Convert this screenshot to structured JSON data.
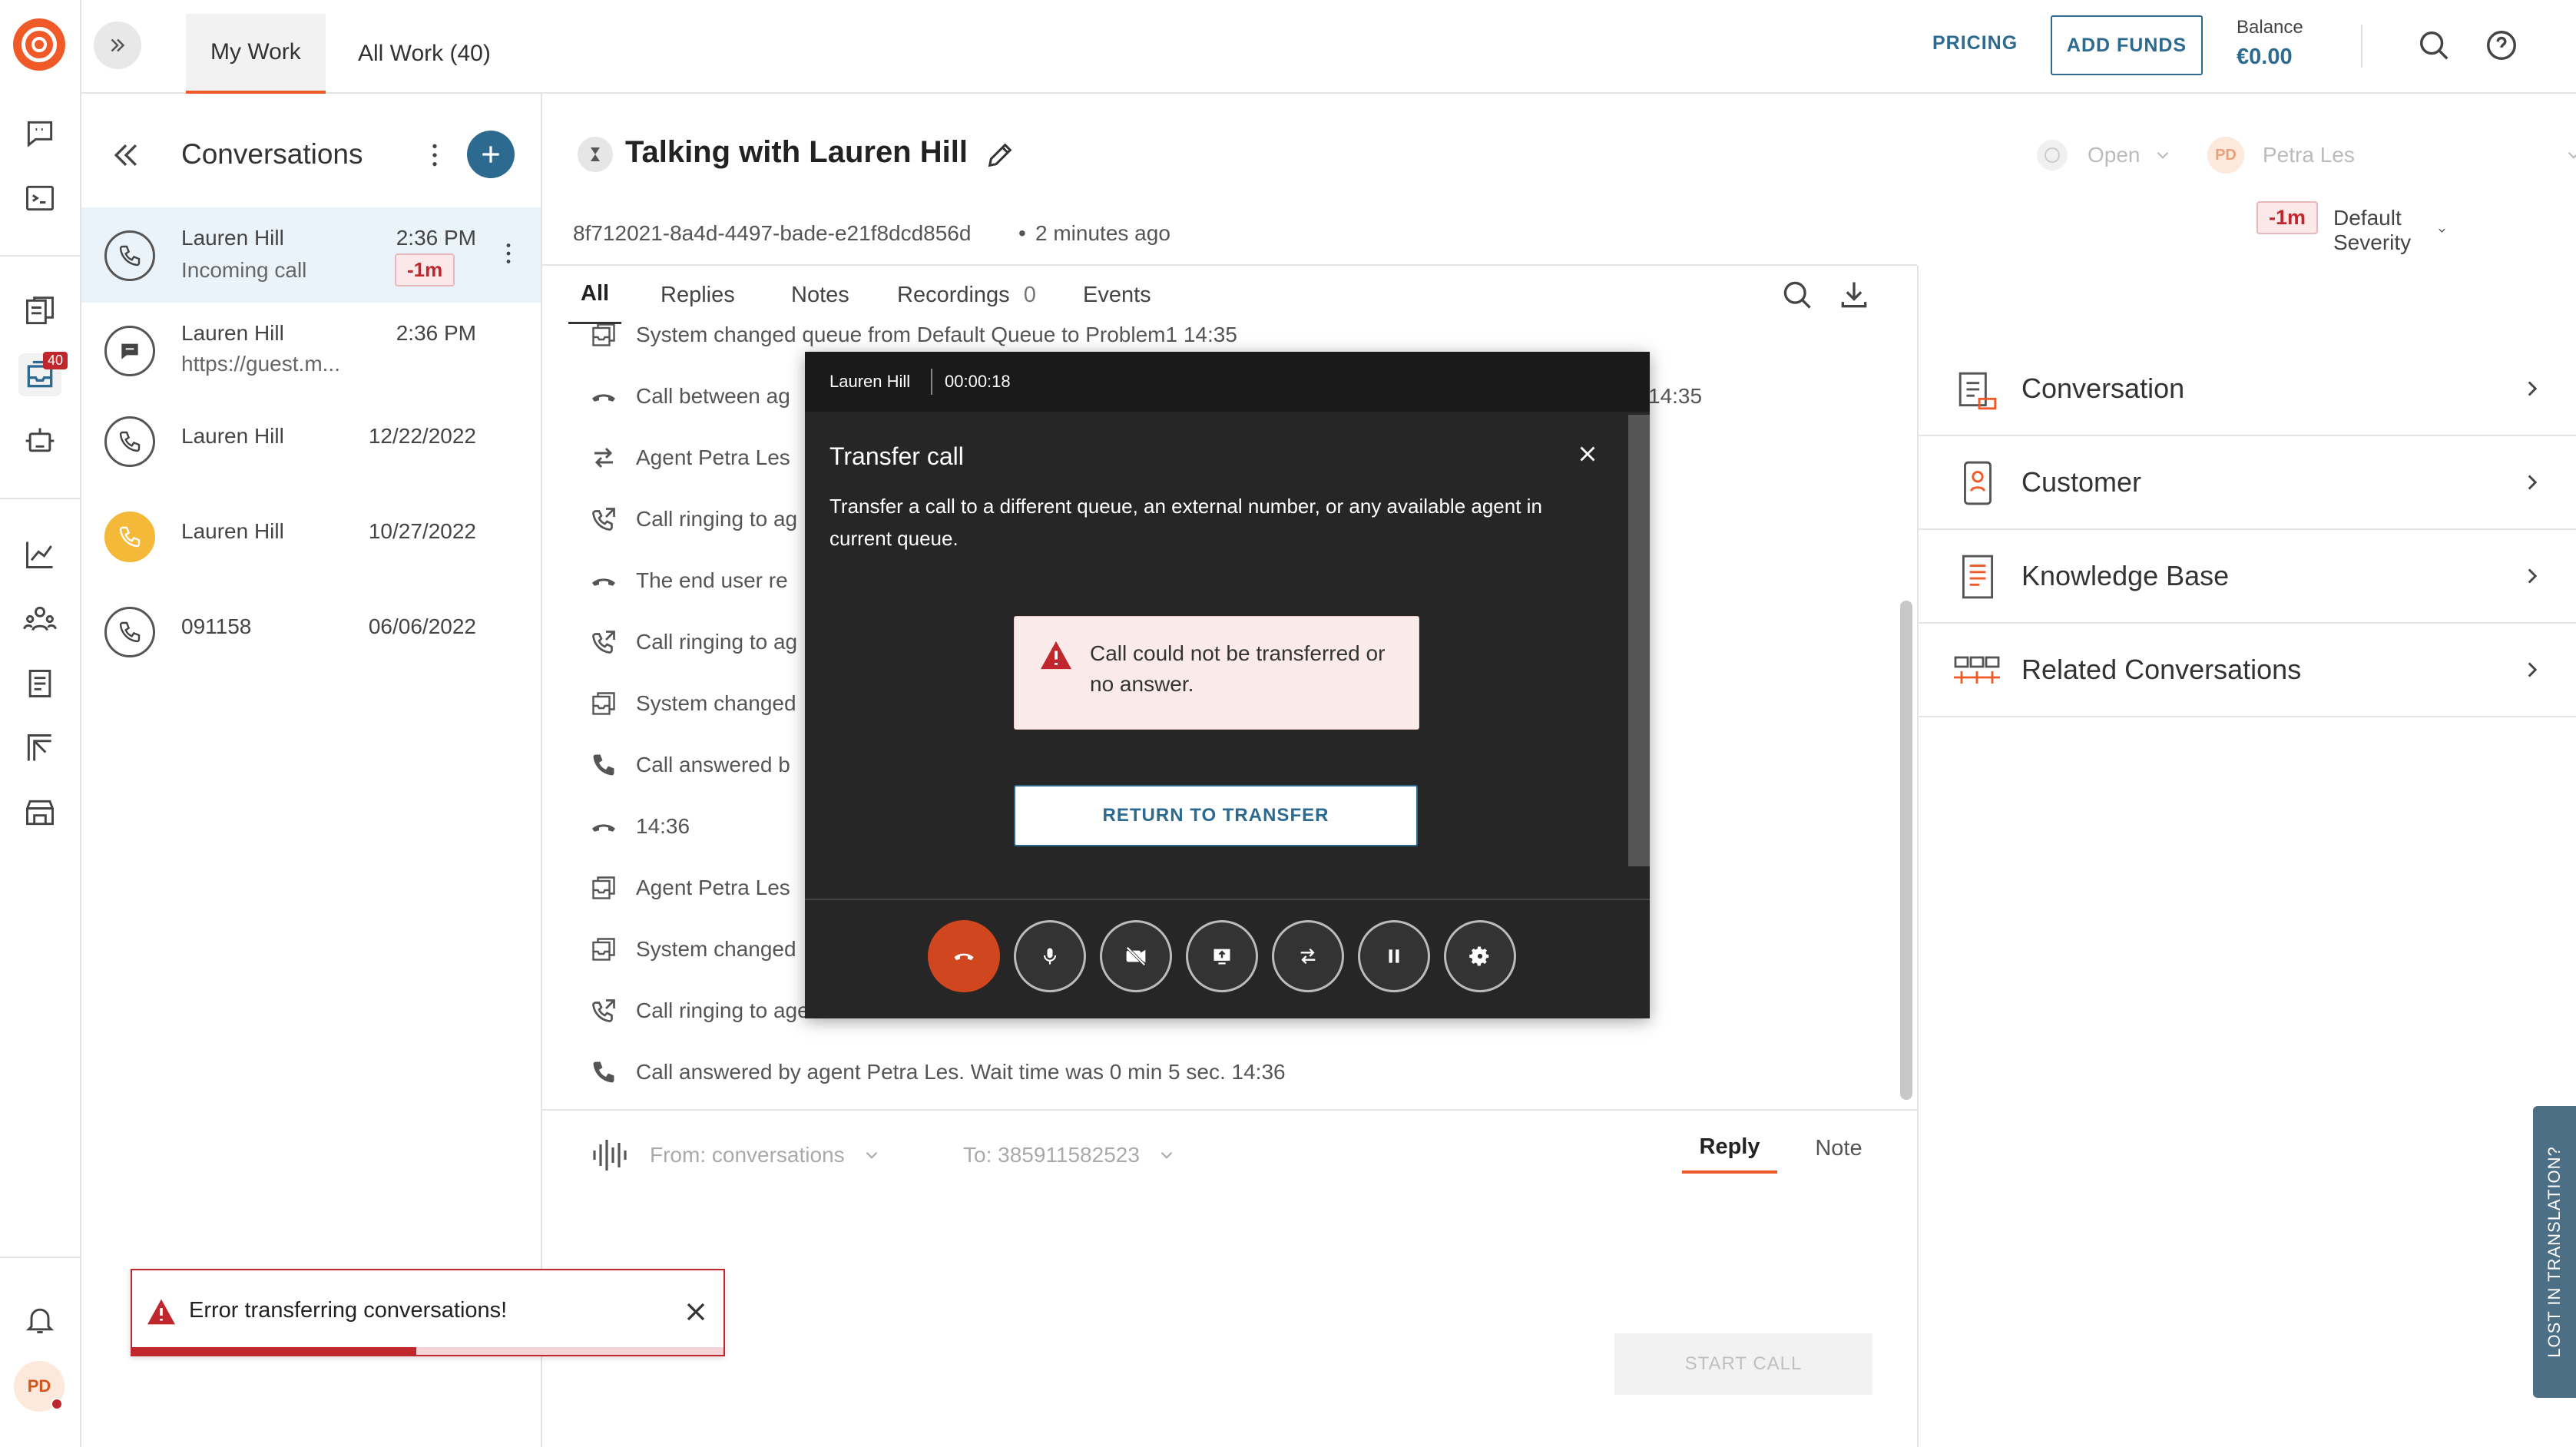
{
  "nav": {
    "items": [
      {
        "name": "conversations-nav",
        "icon": "chat-icon"
      },
      {
        "name": "terminal-nav",
        "icon": "terminal-icon"
      },
      {
        "name": "pages-nav",
        "icon": "pages-icon"
      },
      {
        "name": "inbox-nav",
        "icon": "inbox-icon",
        "badge": "40"
      },
      {
        "name": "bot-nav",
        "icon": "bot-icon"
      },
      {
        "name": "analytics-nav",
        "icon": "chart-icon"
      },
      {
        "name": "people-nav",
        "icon": "people-icon"
      },
      {
        "name": "knowledge-nav",
        "icon": "book-icon"
      },
      {
        "name": "board-nav",
        "icon": "board-icon"
      },
      {
        "name": "store-nav",
        "icon": "store-icon"
      }
    ],
    "avatar_initials": "PD"
  },
  "topbar": {
    "tabs": [
      {
        "label": "My Work",
        "active": true
      },
      {
        "label": "All Work (40)",
        "active": false
      }
    ],
    "pricing_label": "PRICING",
    "add_funds_label": "ADD FUNDS",
    "balance_label": "Balance",
    "balance_value": "€0.00"
  },
  "conversations": {
    "title": "Conversations",
    "items": [
      {
        "name": "Lauren Hill",
        "time": "2:36 PM",
        "sub": "Incoming call",
        "badge": "-1m",
        "type": "call",
        "active": true
      },
      {
        "name": "Lauren Hill",
        "time": "2:36 PM",
        "sub": "https://guest.m...",
        "type": "chat"
      },
      {
        "name": "Lauren Hill",
        "time": "12/22/2022",
        "sub": "",
        "type": "call"
      },
      {
        "name": "Lauren Hill",
        "time": "10/27/2022",
        "sub": "",
        "type": "call-yellow"
      },
      {
        "name": "091158",
        "time": "06/06/2022",
        "sub": "",
        "type": "call"
      }
    ]
  },
  "conversation": {
    "title": "Talking with Lauren Hill",
    "id": "8f712021-8a4d-4497-bade-e21f8dcd856d",
    "age": "2 minutes ago",
    "status": "Open",
    "assignee_initials": "PD",
    "assignee": "Petra Les",
    "sla_badge": "-1m",
    "severity": "Default Severity",
    "tabs": [
      {
        "label": "All",
        "active": true
      },
      {
        "label": "Replies"
      },
      {
        "label": "Notes"
      },
      {
        "label": "Recordings",
        "count": "0"
      },
      {
        "label": "Events"
      }
    ],
    "timeline": [
      {
        "icon": "queue-icon",
        "text": "System changed queue from Default Queue to Problem1  14:35"
      },
      {
        "icon": "hangup-icon",
        "text": "Call between ag",
        "trail": "14:35"
      },
      {
        "icon": "transfer-icon",
        "text": "Agent Petra Les"
      },
      {
        "icon": "ringing-icon",
        "text": "Call ringing to ag"
      },
      {
        "icon": "hangup-icon",
        "text": "The end user re"
      },
      {
        "icon": "ringing-icon",
        "text": "Call ringing to ag"
      },
      {
        "icon": "queue-icon",
        "text": "System changed"
      },
      {
        "icon": "phone-icon",
        "text": "Call answered b"
      },
      {
        "icon": "hangup-icon",
        "text": "14:36"
      },
      {
        "icon": "queue-icon",
        "text": "Agent Petra Les"
      },
      {
        "icon": "queue-icon",
        "text": "System changed"
      },
      {
        "icon": "ringing-icon",
        "text": "Call ringing to agent Petra Les"
      },
      {
        "icon": "phone-icon",
        "text": "Call answered by agent Petra Les. Wait time was 0 min 5 sec.  14:36"
      }
    ],
    "composer": {
      "from": "From: conversations",
      "to": "To: 385911582523",
      "reply_tab": "Reply",
      "note_tab": "Note",
      "start_call": "START CALL"
    }
  },
  "call_widget": {
    "caller": "Lauren Hill",
    "duration": "00:00:18",
    "title": "Transfer call",
    "description": "Transfer a call to a different queue, an external number, or any available agent in current queue.",
    "error_text": "Call could not be transferred or no answer.",
    "return_label": "RETURN TO TRANSFER",
    "controls": [
      "hangup-icon",
      "microphone-icon",
      "video-off-icon",
      "screen-share-icon",
      "transfer-icon",
      "pause-icon",
      "settings-icon"
    ]
  },
  "right_panel": {
    "items": [
      {
        "label": "Conversation",
        "icon": "conversation-icon"
      },
      {
        "label": "Customer",
        "icon": "customer-icon"
      },
      {
        "label": "Knowledge Base",
        "icon": "knowledge-icon"
      },
      {
        "label": "Related Conversations",
        "icon": "related-icon"
      }
    ]
  },
  "feedback_tab": "LOST IN TRANSLATION?",
  "toast": {
    "message": "Error transferring conversations!",
    "progress": 0.48
  },
  "colors": {
    "brand": "#f05a28",
    "accent": "#2d6a8f",
    "error": "#c0272d",
    "badge_bg": "#fbe9ea"
  }
}
